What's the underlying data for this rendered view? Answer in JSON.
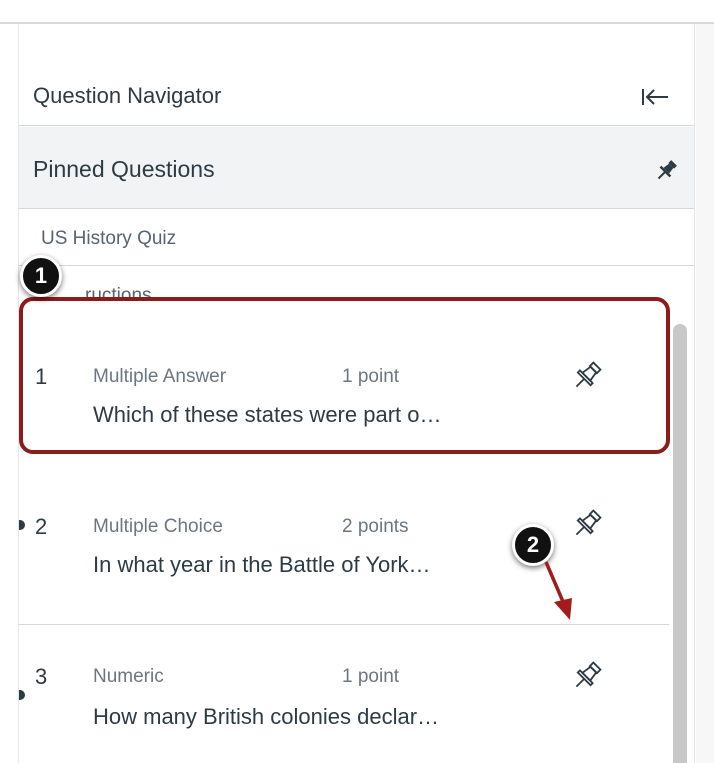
{
  "navigator": {
    "title": "Question Navigator",
    "collapse_icon": "collapse-left-icon"
  },
  "pinned": {
    "title": "Pinned Questions",
    "icon": "pin-icon"
  },
  "quiz": {
    "title": "US History Quiz"
  },
  "instructions": {
    "label": "Instructions",
    "visible_fragment": "ructions"
  },
  "questions": [
    {
      "number": "1",
      "type": "Multiple Answer",
      "points": "1 point",
      "text": "Which of these states were part o…",
      "pin_icon": "pin-outline-icon"
    },
    {
      "number": "2",
      "type": "Multiple Choice",
      "points": "2 points",
      "text": "In what year in the Battle of York…",
      "pin_icon": "pin-outline-icon"
    },
    {
      "number": "3",
      "type": "Numeric",
      "points": "1 point",
      "text": "How many British colonies declar…",
      "pin_icon": "pin-outline-icon"
    }
  ],
  "callouts": [
    {
      "label": "1"
    },
    {
      "label": "2"
    }
  ],
  "colors": {
    "text_primary": "#2d3b45",
    "text_secondary": "#6b7780",
    "highlight": "#8b1c1c",
    "pinned_bg": "#f2f3f4",
    "callout_bg": "#111111",
    "arrow": "#a31b1b"
  }
}
